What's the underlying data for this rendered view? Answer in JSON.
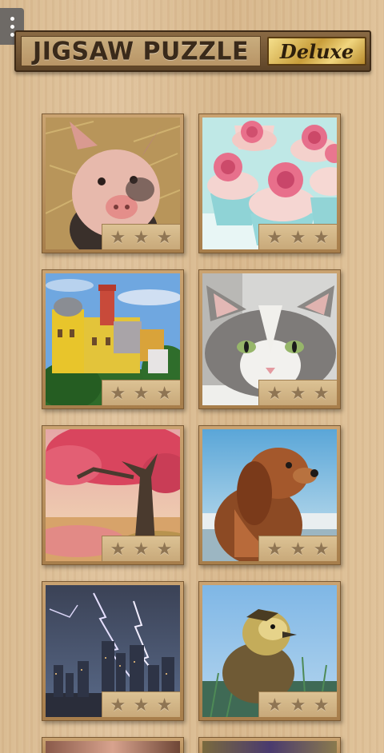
{
  "header": {
    "title": "JIGSAW PUZZLE",
    "badge": "Deluxe"
  },
  "puzzles": [
    {
      "subject": "piglet",
      "stars": 0,
      "stars_total": 3
    },
    {
      "subject": "pink-rose-cupcakes",
      "stars": 0,
      "stars_total": 3
    },
    {
      "subject": "yellow-castle",
      "stars": 0,
      "stars_total": 3
    },
    {
      "subject": "grey-kitten",
      "stars": 0,
      "stars_total": 3
    },
    {
      "subject": "autumn-tree",
      "stars": 0,
      "stars_total": 3
    },
    {
      "subject": "spaniel-dog",
      "stars": 0,
      "stars_total": 3
    },
    {
      "subject": "lightning-city",
      "stars": 0,
      "stars_total": 3
    },
    {
      "subject": "duckling",
      "stars": 0,
      "stars_total": 3
    }
  ],
  "star_glyph": "★",
  "colors": {
    "wood": "#dcbd93",
    "frame": "#b68d5a",
    "star_empty": "#8f7553"
  }
}
